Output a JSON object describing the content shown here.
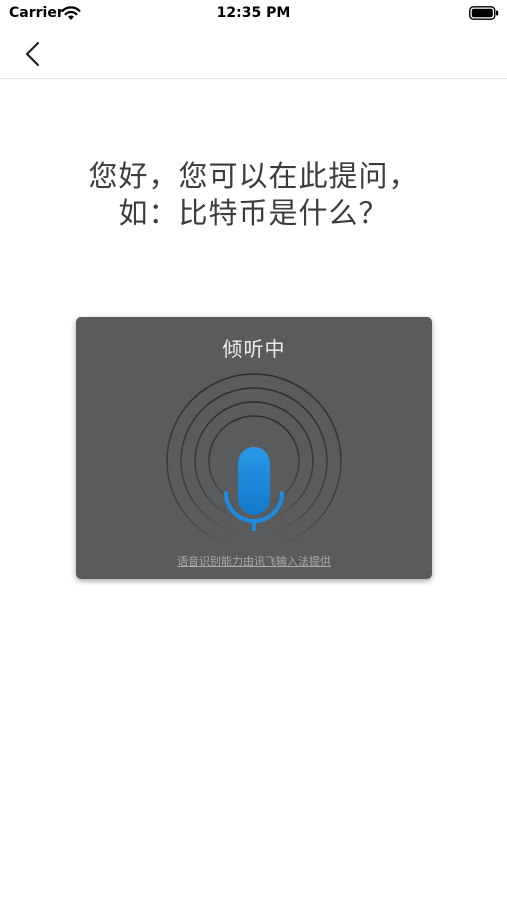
{
  "status_bar": {
    "carrier": "Carrier",
    "time": "12:35 PM",
    "wifi_icon": "wifi-icon",
    "battery_icon": "battery-icon"
  },
  "nav": {
    "back_icon": "chevron-left-icon"
  },
  "prompt": {
    "line1": "您好，您可以在此提问，",
    "line2": "如：比特币是什么？"
  },
  "voice_dialog": {
    "status": "倾听中",
    "mic_icon": "microphone-icon",
    "provider_text": "语音识别能力由讯飞输入法提供",
    "colors": {
      "card_background": "#5a5b5d",
      "mic_blue": "#1a8be0"
    }
  }
}
